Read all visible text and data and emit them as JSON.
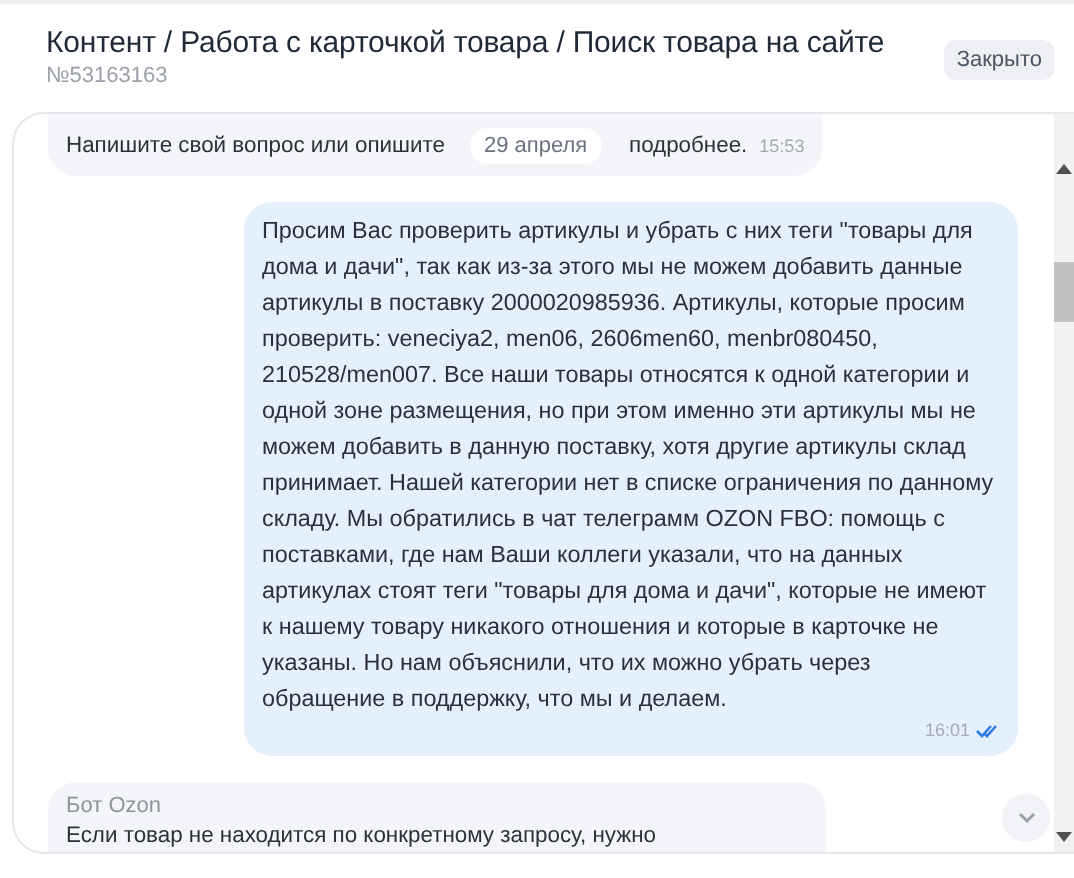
{
  "header": {
    "title": "Контент / Работа с карточкой товара / Поиск товара на сайте",
    "ticket_number": "№53163163",
    "status": "Закрыто"
  },
  "date_separator": "29 апреля",
  "messages": [
    {
      "kind": "incoming",
      "text_parts": [
        "Напишите свой вопрос или опишите",
        "подробнее."
      ],
      "time": "15:53"
    },
    {
      "kind": "outgoing",
      "text": "Просим Вас проверить артикулы и убрать с них теги \"товары для дома и дачи\", так как из-за этого мы не можем добавить данные артикулы в поставку 2000020985936. Артикулы, которые просим проверить: veneciya2, men06, 2606men60, menbr080450, 210528/men007. Все наши товары относятся к одной категории и одной зоне размещения, но при этом именно эти артикулы мы не можем добавить в данную поставку, хотя другие артикулы склад принимает. Нашей категории нет в списке ограничения по данному складу. Мы обратились в чат телеграмм OZON FBO: помощь с поставками, где нам Ваши коллеги указали, что на данных артикулах стоят теги \"товары для дома и дачи\", которые не имеют к нашему товару никакого отношения и которые в карточке не указаны. Но нам объяснили, что их можно убрать через обращение в поддержку, что мы и делаем.",
      "time": "16:01",
      "read": true
    },
    {
      "kind": "incoming",
      "sender": "Бот Ozon",
      "text": "Если товар не находится по конкретному запросу, нужно"
    }
  ]
}
